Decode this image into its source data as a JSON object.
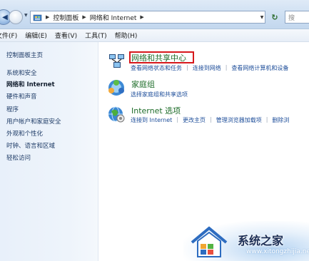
{
  "address_bar": {
    "breadcrumb": [
      "控制面板",
      "网络和 Internet"
    ],
    "search_placeholder": "搜"
  },
  "menu": [
    "文件(F)",
    "编辑(E)",
    "查看(V)",
    "工具(T)",
    "帮助(H)"
  ],
  "sidebar": {
    "items": [
      {
        "label": "控制面板主页"
      },
      {
        "label": "系统和安全"
      },
      {
        "label": "网络和 Internet"
      },
      {
        "label": "硬件和声音"
      },
      {
        "label": "程序"
      },
      {
        "label": "用户帐户和家庭安全"
      },
      {
        "label": "外观和个性化"
      },
      {
        "label": "时钟、语言和区域"
      },
      {
        "label": "轻松访问"
      }
    ]
  },
  "categories": [
    {
      "title": "网络和共享中心",
      "icon": "network-sharing-icon",
      "links": [
        "查看网络状态和任务",
        "连接到网络",
        "查看网络计算机和设备"
      ]
    },
    {
      "title": "家庭组",
      "icon": "homegroup-icon",
      "links": [
        "选择家庭组和共享选项"
      ]
    },
    {
      "title": "Internet 选项",
      "icon": "internet-options-icon",
      "links": [
        "连接到 Internet",
        "更改主页",
        "管理浏览器加载项",
        "删除浏"
      ]
    }
  ],
  "watermark": {
    "title": "系统之家",
    "url": "www.xitongzhijia.net"
  },
  "colors": {
    "highlight_box": "#d6181b",
    "category_title": "#1f6d2a",
    "link": "#1e4e9a"
  }
}
